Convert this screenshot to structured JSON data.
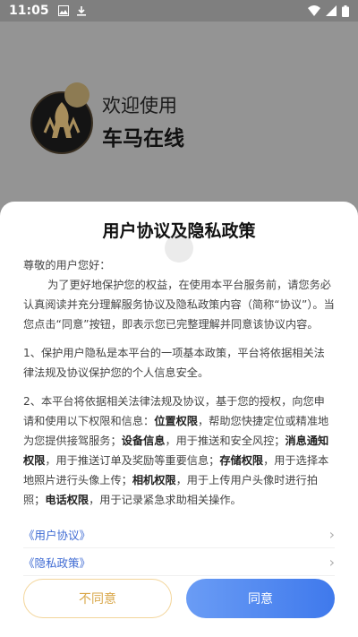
{
  "status": {
    "time": "11:05",
    "icons_left": [
      "image-icon",
      "download-icon"
    ],
    "icons_right": [
      "wifi-icon",
      "signal-icon",
      "battery-icon"
    ]
  },
  "header": {
    "welcome": "欢迎使用",
    "app_name": "车马在线"
  },
  "dialog": {
    "title": "用户协议及隐私政策",
    "greeting": "尊敬的用户您好：",
    "para1": "为了更好地保护您的权益，在使用本平台服务前，请您务必认真阅读并充分理解服务协议及隐私政策内容（简称“协议”）。当您点击“同意”按钮，即表示您已完整理解并同意该协议内容。",
    "para2": "1、保护用户隐私是本平台的一项基本政策，平台将依据相关法律法规及协议保护您的个人信息安全。",
    "para3": [
      {
        "t": "2、本平台将依据相关法律法规及协议，基于您的授权，向您申请和使用以下权限和信息：",
        "b": false
      },
      {
        "t": "位置权限",
        "b": true
      },
      {
        "t": "，帮助您快捷定位或精准地为您提供接驾服务；",
        "b": false
      },
      {
        "t": "设备信息",
        "b": true
      },
      {
        "t": "，用于推送和安全风控；",
        "b": false
      },
      {
        "t": "消息通知权限",
        "b": true
      },
      {
        "t": "，用于推送订单及奖励等重要信息；",
        "b": false
      },
      {
        "t": "存储权限",
        "b": true
      },
      {
        "t": "，用于选择本地照片进行头像上传；",
        "b": false
      },
      {
        "t": "相机权限",
        "b": true
      },
      {
        "t": "，用于上传用户头像时进行拍照；",
        "b": false
      },
      {
        "t": "电话权限",
        "b": true
      },
      {
        "t": "，用于记录紧急求助相关操作。",
        "b": false
      }
    ],
    "links": [
      {
        "label": "《用户协议》"
      },
      {
        "label": "《隐私政策》"
      }
    ],
    "disagree": "不同意",
    "agree": "同意"
  }
}
